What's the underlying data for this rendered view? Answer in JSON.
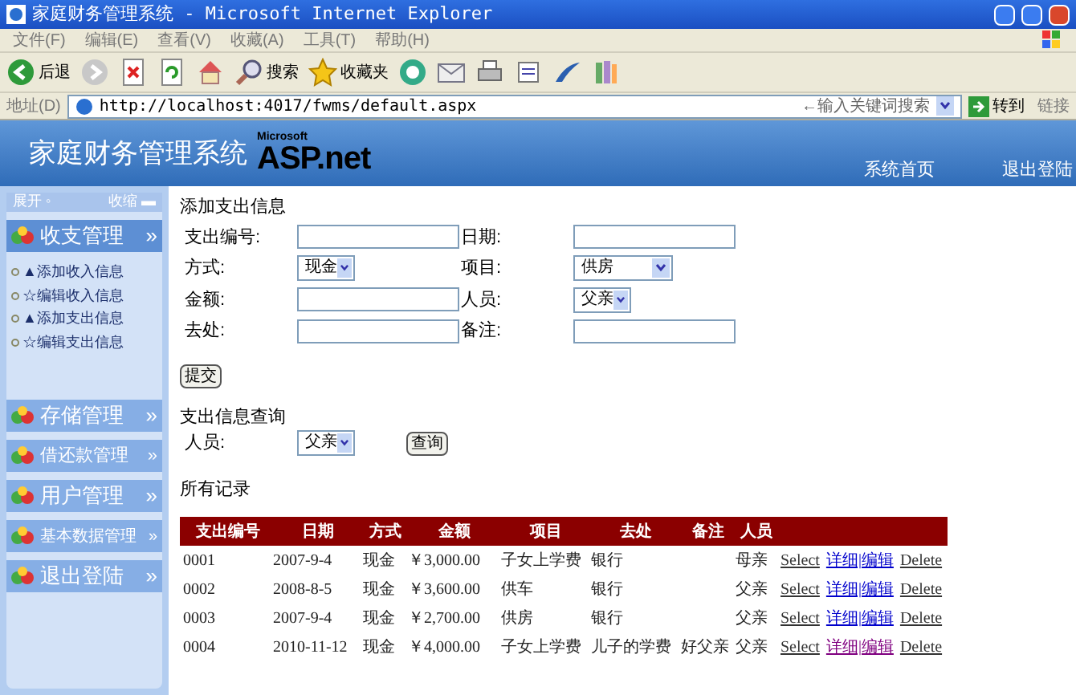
{
  "window": {
    "title": "家庭财务管理系统 - Microsoft Internet Explorer"
  },
  "menu": [
    "文件(F)",
    "编辑(E)",
    "查看(V)",
    "收藏(A)",
    "工具(T)",
    "帮助(H)"
  ],
  "toolbar": [
    {
      "kind": "back",
      "label": "后退"
    },
    {
      "kind": "forward"
    },
    {
      "kind": "stop"
    },
    {
      "kind": "refresh"
    },
    {
      "kind": "home"
    },
    {
      "kind": "search",
      "label": "搜索"
    },
    {
      "kind": "favorites",
      "label": "收藏夹"
    },
    {
      "kind": "media"
    },
    {
      "kind": "mail"
    },
    {
      "kind": "print"
    },
    {
      "kind": "edit"
    },
    {
      "kind": "messenger"
    },
    {
      "kind": "research"
    }
  ],
  "address_bar": {
    "label": "地址(D)",
    "url": "http://localhost:4017/fwms/default.aspx",
    "search_placeholder": "←输入关键词搜索",
    "go": "转到",
    "links": "链接"
  },
  "header": {
    "title": "家庭财务管理系统",
    "logo_small": "Microsoft",
    "logo": "ASP.net",
    "nav": [
      "系统首页",
      "退出登陆"
    ]
  },
  "sidebar": {
    "expand": "展开",
    "expand_mark": "◦",
    "collapse": "收缩",
    "collapse_mark": "▬",
    "sections": [
      {
        "label": "收支管理",
        "arrow": "»",
        "expanded": true,
        "children": [
          {
            "label": "▲添加收入信息"
          },
          {
            "label": "☆编辑收入信息"
          },
          {
            "label": "▲添加支出信息"
          },
          {
            "label": "☆编辑支出信息"
          }
        ]
      },
      {
        "label": "存储管理",
        "arrow": "»",
        "expanded": false
      },
      {
        "label": "借还款管理",
        "arrow": "»",
        "expanded": false
      },
      {
        "label": "用户管理",
        "arrow": "»",
        "expanded": false
      },
      {
        "label": "基本数据管理",
        "arrow": "»",
        "expanded": false
      },
      {
        "label": "退出登陆",
        "arrow": "»",
        "expanded": false
      }
    ]
  },
  "add_form": {
    "title": "添加支出信息",
    "fields": [
      {
        "label": "支出编号:",
        "kind": "text"
      },
      {
        "label": "日期:",
        "kind": "text"
      },
      {
        "label": "方式:",
        "kind": "select",
        "value": "现金"
      },
      {
        "label": "项目:",
        "kind": "select",
        "value": "供房"
      },
      {
        "label": "金额:",
        "kind": "text"
      },
      {
        "label": "人员:",
        "kind": "select",
        "value": "父亲"
      },
      {
        "label": "去处:",
        "kind": "text"
      },
      {
        "label": "备注:",
        "kind": "text"
      }
    ],
    "submit": "提交"
  },
  "query": {
    "title": "支出信息查询",
    "label": "人员:",
    "value": "父亲",
    "button": "查询"
  },
  "records": {
    "title": "所有记录",
    "columns": [
      "支出编号",
      "日期",
      "方式",
      "金额",
      "项目",
      "去处",
      "备注",
      "人员"
    ],
    "rows": [
      {
        "cells": [
          "0001",
          "2007-9-4",
          "现金",
          "￥3,000.00",
          "子女上学费",
          "银行",
          "",
          "母亲"
        ],
        "select": "Select",
        "detail": "详细|编辑",
        "delete": "Delete",
        "visited": false
      },
      {
        "cells": [
          "0002",
          "2008-8-5",
          "现金",
          "￥3,600.00",
          "供车",
          "银行",
          "",
          "父亲"
        ],
        "select": "Select",
        "detail": "详细|编辑",
        "delete": "Delete",
        "visited": false
      },
      {
        "cells": [
          "0003",
          "2007-9-4",
          "现金",
          "￥2,700.00",
          "供房",
          "银行",
          "",
          "父亲"
        ],
        "select": "Select",
        "detail": "详细|编辑",
        "delete": "Delete",
        "visited": false
      },
      {
        "cells": [
          "0004",
          "2010-11-12",
          "现金",
          "￥4,000.00",
          "子女上学费",
          "儿子的学费",
          "好父亲",
          "父亲"
        ],
        "select": "Select",
        "detail": "详细|编辑",
        "delete": "Delete",
        "visited": true
      }
    ]
  }
}
